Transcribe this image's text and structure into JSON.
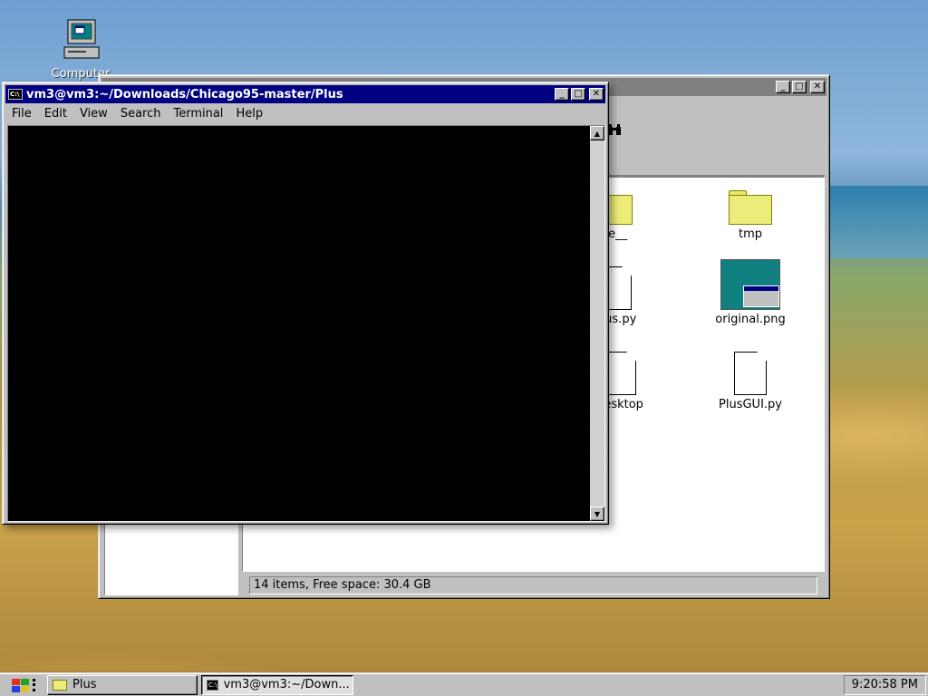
{
  "desktop": {
    "icons": [
      {
        "label": "Computer",
        "icon": "computer-icon"
      }
    ]
  },
  "file_manager": {
    "status": "14 items, Free space: 30.4 GB",
    "files": [
      {
        "label": "che__",
        "icon": "folder-icon"
      },
      {
        "label": "tmp",
        "icon": "folder-icon"
      },
      {
        "label": "Plus.py",
        "icon": "document-icon"
      },
      {
        "label": "original.png",
        "icon": "image-icon"
      },
      {
        "label": "desktop",
        "icon": "document-icon"
      },
      {
        "label": "PlusGUI.py",
        "icon": "document-icon"
      }
    ]
  },
  "terminal": {
    "title": "vm3@vm3:~/Downloads/Chicago95-master/Plus",
    "menu": [
      "File",
      "Edit",
      "View",
      "Search",
      "Terminal",
      "Help"
    ]
  },
  "taskbar": {
    "tasks": [
      {
        "label": "Plus",
        "icon": "folder-icon"
      },
      {
        "label": "vm3@vm3:~/Down...",
        "icon": "terminal-icon"
      }
    ],
    "clock": "9:20:58 PM"
  },
  "colors": {
    "titlebar_active": "#000080",
    "face": "#c0c0c0"
  }
}
